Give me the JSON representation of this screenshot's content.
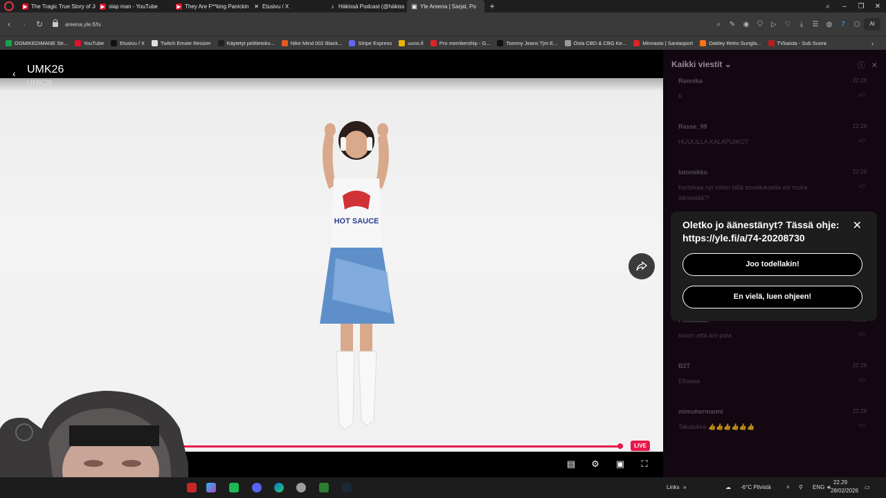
{
  "browser": {
    "tabs": [
      {
        "label": "The Tragic True Story of Ju",
        "color": "#e0102a"
      },
      {
        "label": "slap man - YouTube",
        "color": "#e0102a"
      },
      {
        "label": "They Are F**king Panickin",
        "color": "#e0102a"
      },
      {
        "label": "Etusivu / X",
        "color": "#000000"
      },
      {
        "label": "Häkissä Podcast (@häkiss",
        "color": "#000000"
      },
      {
        "label": "Yle Areena | Sarjat, Po",
        "color": "#555555"
      }
    ],
    "url": "areena.yle.fi/tv",
    "ai_button": "AI"
  },
  "bookmarks": [
    {
      "label": "OGMIKEDIMANE Str...",
      "color": "#16a34a"
    },
    {
      "label": "YouTube",
      "color": "#e0102a"
    },
    {
      "label": "Etusivu / X",
      "color": "#111111"
    },
    {
      "label": "Twitch Emote Resizer",
      "color": "#dddddd"
    },
    {
      "label": "Käytetyt pelitietoko...",
      "color": "#222222"
    },
    {
      "label": "Nike Mind 002 Black...",
      "color": "#e35a1f"
    },
    {
      "label": "Stripe Express",
      "color": "#6366f1"
    },
    {
      "label": "uuno.fi",
      "color": "#eab308"
    },
    {
      "label": "Pro membership - G...",
      "color": "#dc2626"
    },
    {
      "label": "Tommy Jeans Tjm E...",
      "color": "#111111"
    },
    {
      "label": "Osta CBD & CBG Ke...",
      "color": "#999999"
    },
    {
      "label": "Minnasto | Santasport",
      "color": "#dc2626"
    },
    {
      "label": "Oakley Retro Sungla...",
      "color": "#f97316"
    },
    {
      "label": "TVkaista - Sub Suora",
      "color": "#b91c1c"
    }
  ],
  "player": {
    "title": "UMK26",
    "subtitle": "UMK26",
    "live_label": "LIVE"
  },
  "chat": {
    "header": "Kaikki viestit",
    "messages": [
      {
        "user": "Rannika",
        "time": "22:28",
        "text": "6"
      },
      {
        "user": "Rasse_99",
        "time": "22:28",
        "text": "HUULILLA KALAPUIKOT"
      },
      {
        "user": "latomikko",
        "time": "22:29",
        "text": "Kertokaa nyt miten tällä sovelluksella voi muka äänestää?!"
      },
      {
        "user": "Pinkasade",
        "time": "22:29",
        "text": "toivon että ant-pala"
      },
      {
        "user": "B2T",
        "time": "22:29",
        "text": "Ettaaaa"
      },
      {
        "user": "mimuhermanni",
        "time": "22:29",
        "text": "Takatukka 👍👍👍👍👍👍"
      }
    ]
  },
  "popup": {
    "question": "Oletko jo äänestänyt? Tässä ohje: https://yle.fi/a/74-20208730",
    "yes_button": "Joo todellakin!",
    "no_button": "En vielä, luen ohjeen!"
  },
  "taskbar": {
    "links_label": "Links",
    "weather": "-6°C  Pilvistä",
    "language": "ENG",
    "time": "22.29",
    "date": "28/02/2026"
  }
}
